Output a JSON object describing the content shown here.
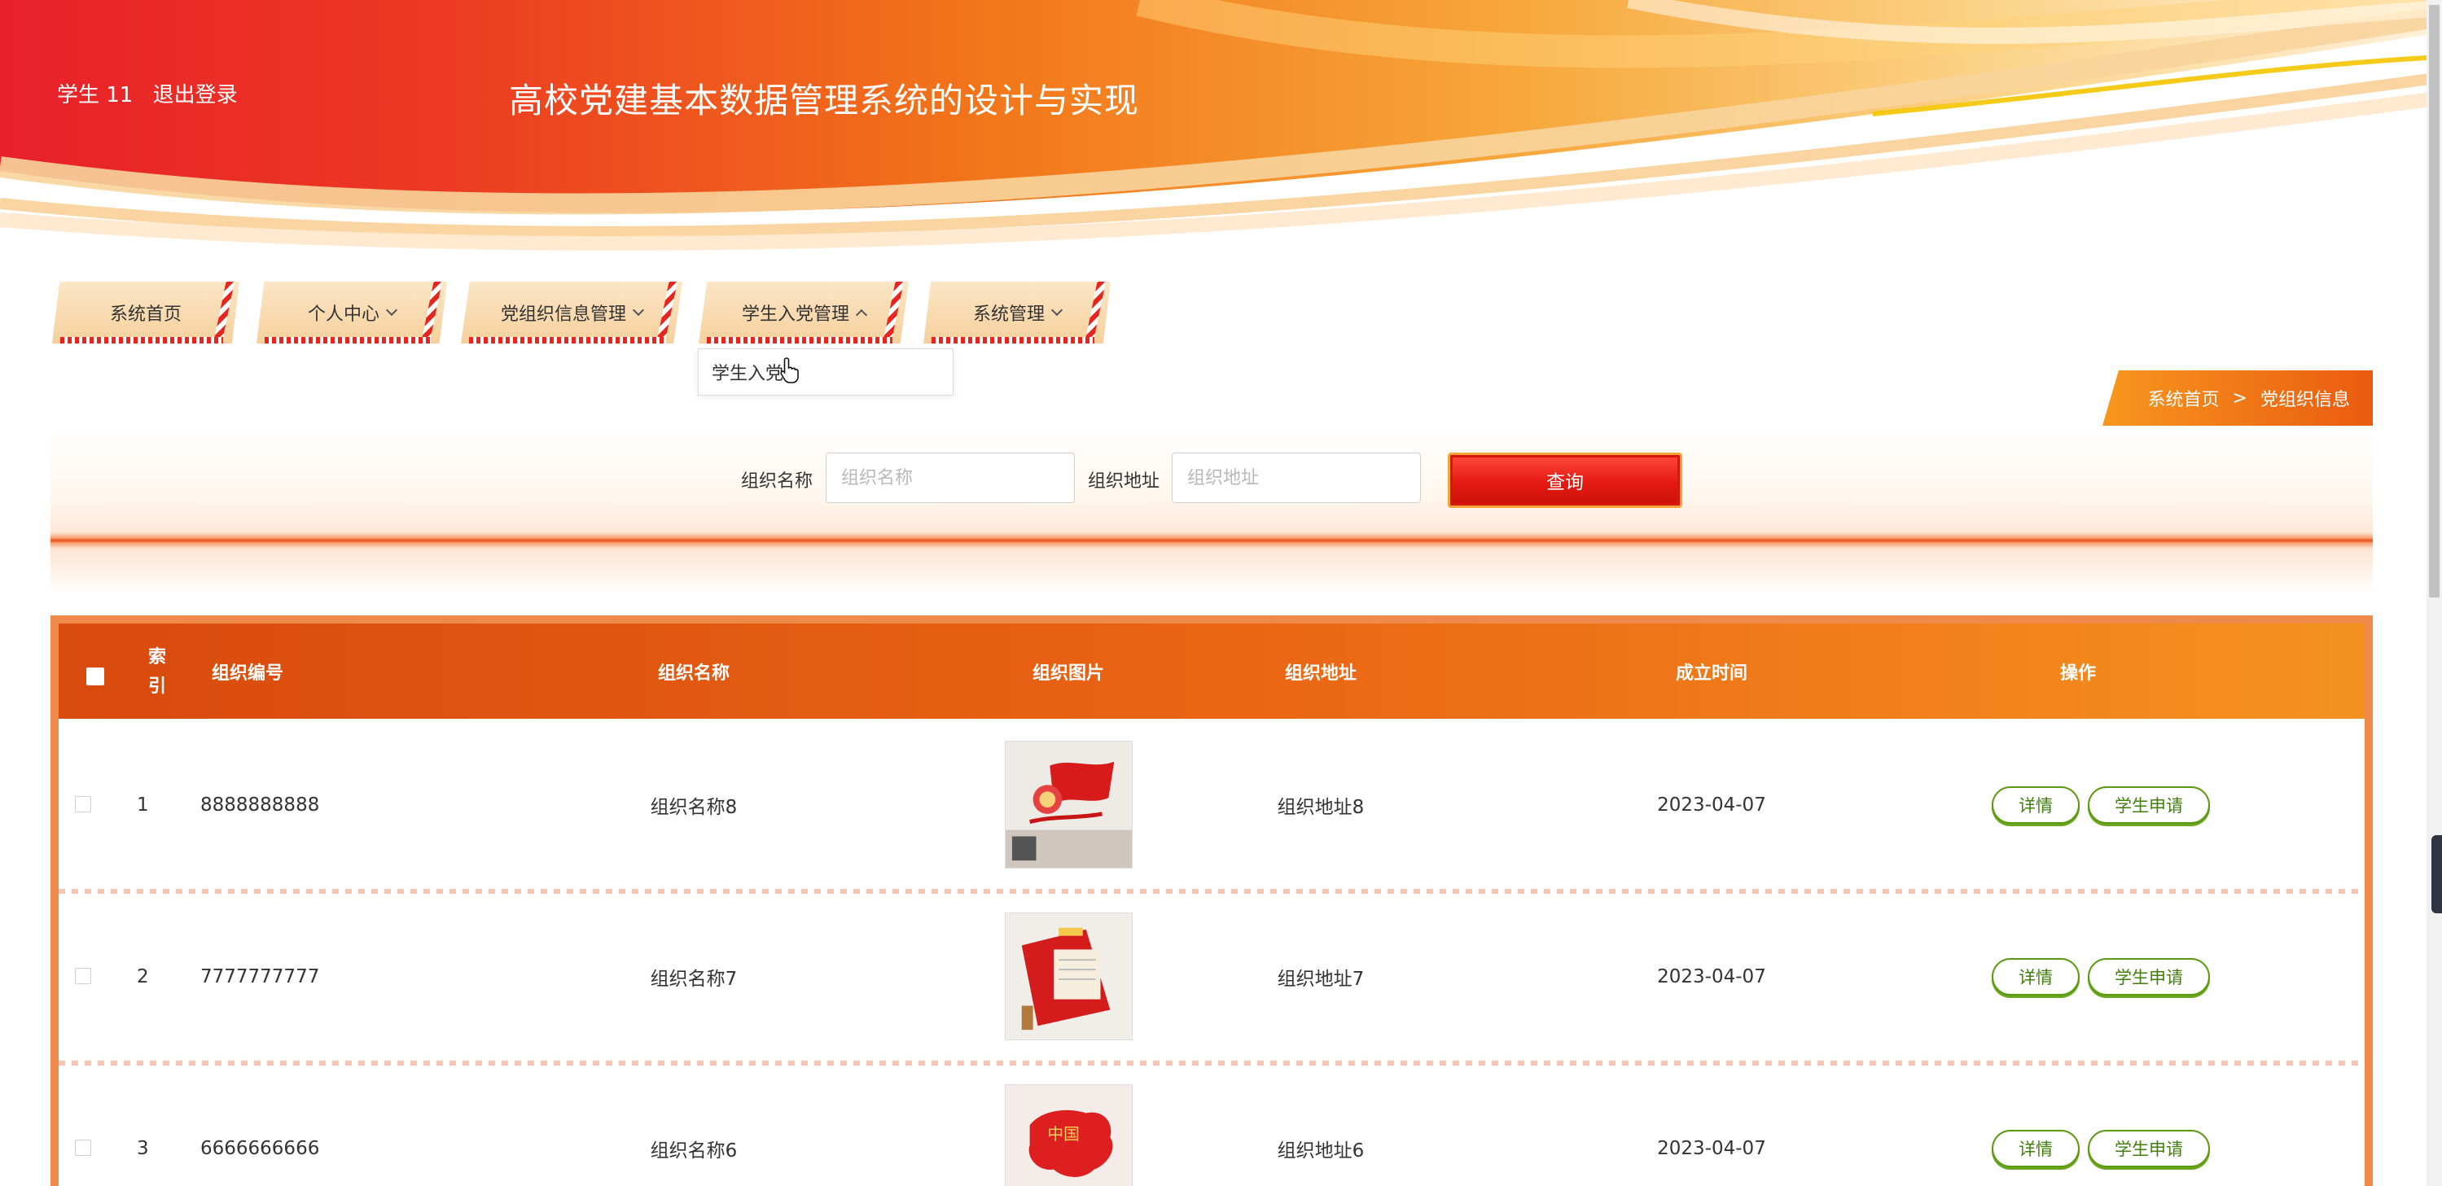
{
  "header": {
    "user_label": "学生 11",
    "logout_label": "退出登录",
    "site_title": "高校党建基本数据管理系统的设计与实现"
  },
  "nav": {
    "items": [
      {
        "label": "系统首页",
        "has_dropdown": false
      },
      {
        "label": "个人中心",
        "has_dropdown": true
      },
      {
        "label": "党组织信息管理",
        "has_dropdown": true
      },
      {
        "label": "学生入党管理",
        "has_dropdown": true,
        "open": true
      },
      {
        "label": "系统管理",
        "has_dropdown": true
      }
    ],
    "dropdown_item": "学生入党"
  },
  "breadcrumb": {
    "home": "系统首页",
    "separator": ">",
    "current": "党组织信息"
  },
  "search": {
    "name_label": "组织名称",
    "name_placeholder": "组织名称",
    "address_label": "组织地址",
    "address_placeholder": "组织地址",
    "button_label": "查询"
  },
  "table": {
    "headers": {
      "index": "索引",
      "code": "组织编号",
      "name": "组织名称",
      "image": "组织图片",
      "address": "组织地址",
      "established": "成立时间",
      "actions": "操作"
    },
    "rows": [
      {
        "index": "1",
        "code": "8888888888",
        "name": "组织名称8",
        "address": "组织地址8",
        "established": "2023-04-07"
      },
      {
        "index": "2",
        "code": "7777777777",
        "name": "组织名称7",
        "address": "组织地址7",
        "established": "2023-04-07"
      },
      {
        "index": "3",
        "code": "6666666666",
        "name": "组织名称6",
        "address": "组织地址6",
        "established": "2023-04-07"
      }
    ],
    "detail_label": "详情",
    "apply_label": "学生申请"
  },
  "colors": {
    "primary_red": "#e6251f",
    "header_orange": "#ea6414",
    "action_green": "#5a9a10"
  }
}
